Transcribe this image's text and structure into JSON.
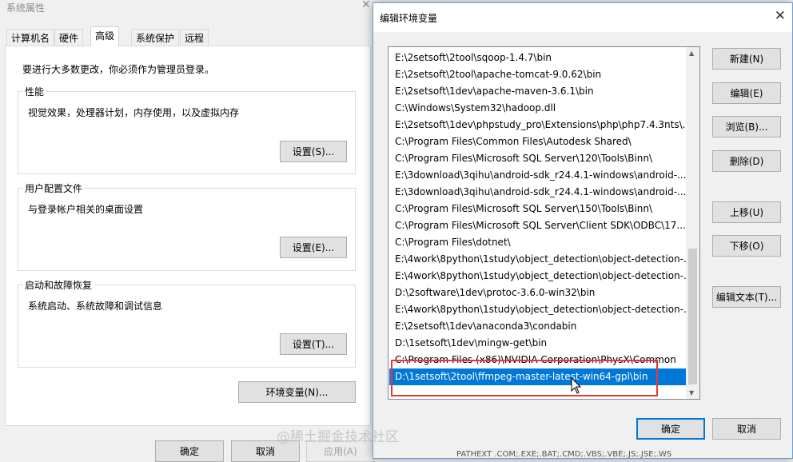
{
  "system_window": {
    "title": "系统属性",
    "close": "✕",
    "tabs": [
      "计算机名",
      "硬件",
      "高级",
      "系统保护",
      "远程"
    ],
    "admin_note": "要进行大多数更改，你必须作为管理员登录。",
    "performance": {
      "label": "性能",
      "description": "视觉效果，处理器计划，内存使用，以及虚拟内存",
      "button": "设置(S)..."
    },
    "user_profiles": {
      "label": "用户配置文件",
      "description": "与登录帐户相关的桌面设置",
      "button": "设置(E)..."
    },
    "startup_recovery": {
      "label": "启动和故障恢复",
      "description": "系统启动、系统故障和调试信息",
      "button": "设置(T)..."
    },
    "env_vars_button": "环境变量(N)...",
    "ok_button": "确定",
    "cancel_button": "取消",
    "apply_button": "应用(A)"
  },
  "env_dialog": {
    "title": "编辑环境变量",
    "close": "✕",
    "paths": [
      "E:\\2setsoft\\2tool\\sqoop-1.4.7\\bin",
      "E:\\2setsoft\\2tool\\apache-tomcat-9.0.62\\bin",
      "E:\\2setsoft\\1dev\\apache-maven-3.6.1\\bin",
      "C:\\Windows\\System32\\hadoop.dll",
      "E:\\2setsoft\\1dev\\phpstudy_pro\\Extensions\\php\\php7.4.3nts\\...",
      "C:\\Program Files\\Common Files\\Autodesk Shared\\",
      "C:\\Program Files\\Microsoft SQL Server\\120\\Tools\\Binn\\",
      "E:\\3download\\3qihu\\android-sdk_r24.4.1-windows\\android-...",
      "E:\\3download\\3qihu\\android-sdk_r24.4.1-windows\\android-...",
      "C:\\Program Files\\Microsoft SQL Server\\150\\Tools\\Binn\\",
      "C:\\Program Files\\Microsoft SQL Server\\Client SDK\\ODBC\\17...",
      "C:\\Program Files\\dotnet\\",
      "E:\\4work\\8python\\1study\\object_detection\\object-detection-...",
      "E:\\4work\\8python\\1study\\object_detection\\object-detection-...",
      "D:\\2software\\1dev\\protoc-3.6.0-win32\\bin",
      "E:\\4work\\8python\\1study\\object_detection\\object-detection-...",
      "E:\\2setsoft\\1dev\\anaconda3\\condabin",
      "D:\\1setsoft\\1dev\\mingw-get\\bin",
      "C:\\Program Files (x86)\\NVIDIA Corporation\\PhysX\\Common",
      "D:\\1setsoft\\2tool\\ffmpeg-master-latest-win64-gpl\\bin"
    ],
    "selected_path": "D:\\1setsoft\\2tool\\ffmpeg-master-latest-win64-gpl\\bin",
    "buttons": {
      "new": "新建(N)",
      "edit": "编辑(E)",
      "browse": "浏览(B)...",
      "delete": "删除(D)",
      "move_up": "上移(U)",
      "move_down": "下移(O)",
      "edit_text": "编辑文本(T)...",
      "ok": "确定",
      "cancel": "取消"
    },
    "scroll_up": "▲",
    "scroll_down": "▼"
  },
  "watermark": "@稀土掘金技术社区",
  "bottom_strip": "PATHEXT        .COM;.EXE;.BAT;.CMD;.VBS;.VBE;.JS;.JSE;.WS",
  "colors": {
    "selection": "#0078d7",
    "highlight_box": "#e53935",
    "focus_border": "#0078d7"
  }
}
